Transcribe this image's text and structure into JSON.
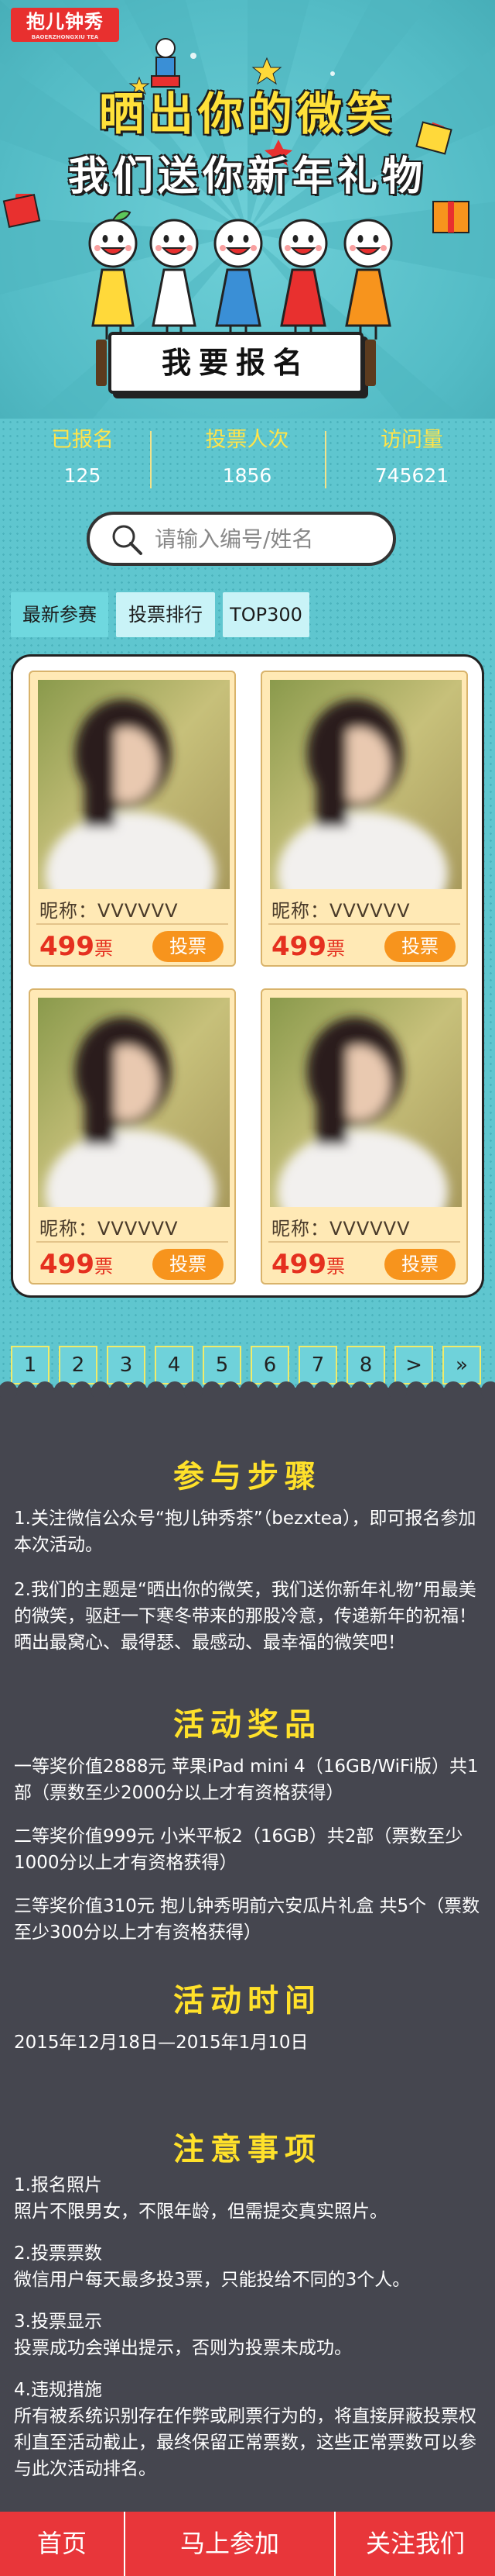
{
  "brand": {
    "logo_text": "抱儿钟秀",
    "logo_sub": "BAOERZHONGXIU TEA"
  },
  "hero": {
    "title_line1": "晒出你的微笑",
    "title_line2": "我们送你新年礼物",
    "signup_label": "我要报名"
  },
  "stats": [
    {
      "label": "已报名",
      "value": "125"
    },
    {
      "label": "投票人次",
      "value": "1856"
    },
    {
      "label": "访问量",
      "value": "745621"
    }
  ],
  "search": {
    "placeholder": "请输入编号/姓名"
  },
  "tabs": [
    {
      "label": "最新参赛"
    },
    {
      "label": "投票排行"
    },
    {
      "label": "TOP300"
    }
  ],
  "cards": [
    {
      "nickname": "昵称：VVVVVV",
      "votes": "499",
      "votes_unit": "票",
      "vote_label": "投票"
    },
    {
      "nickname": "昵称：VVVVVV",
      "votes": "499",
      "votes_unit": "票",
      "vote_label": "投票"
    },
    {
      "nickname": "昵称：VVVVVV",
      "votes": "499",
      "votes_unit": "票",
      "vote_label": "投票"
    },
    {
      "nickname": "昵称：VVVVVV",
      "votes": "499",
      "votes_unit": "票",
      "vote_label": "投票"
    }
  ],
  "pagination": [
    "1",
    "2",
    "3",
    "4",
    "5",
    "6",
    "7",
    "8",
    ">",
    "»"
  ],
  "sections": {
    "steps": {
      "title": "参与步骤",
      "items": [
        "1.关注微信公众号“抱儿钟秀茶”（bezxtea），即可报名参加本次活动。",
        "2.我们的主题是“晒出你的微笑，我们送你新年礼物”用最美的微笑，驱赶一下寒冬带来的那股冷意，传递新年的祝福！晒出最窝心、最得瑟、最感动、最幸福的微笑吧！"
      ]
    },
    "prizes": {
      "title": "活动奖品",
      "items": [
        "一等奖价值2888元 苹果iPad mini 4（16GB/WiFi版）共1部（票数至少2000分以上才有资格获得）",
        "二等奖价值999元  小米平板2（16GB）共2部（票数至少1000分以上才有资格获得）",
        "三等奖价值310元 抱儿钟秀明前六安瓜片礼盒  共5个（票数至少300分以上才有资格获得）"
      ]
    },
    "time": {
      "title": "活动时间",
      "text": "2015年12月18日—2015年1月10日"
    },
    "notes": {
      "title": "注意事项",
      "items": [
        {
          "head": "1.报名照片",
          "body": "照片不限男女，不限年龄，但需提交真实照片。"
        },
        {
          "head": "2.投票票数",
          "body": "微信用户每天最多投3票，只能投给不同的3个人。"
        },
        {
          "head": "3.投票显示",
          "body": "投票成功会弹出提示，否则为投票未成功。"
        },
        {
          "head": "4.违规措施",
          "body": "所有被系统识别存在作弊或刷票行为的，将直接屏蔽投票权利直至活动截止，最终保留正常票数，这些正常票数可以参与此次活动排名。"
        }
      ]
    }
  },
  "footer": [
    {
      "label": "首页"
    },
    {
      "label": "马上参加"
    },
    {
      "label": "关注我们"
    }
  ],
  "colors": {
    "teal": "#5fc6cf",
    "yellow": "#ffe13a",
    "dark": "#45464f",
    "red": "#e8363a",
    "orange": "#f7941d",
    "vote_red": "#e5301f"
  }
}
